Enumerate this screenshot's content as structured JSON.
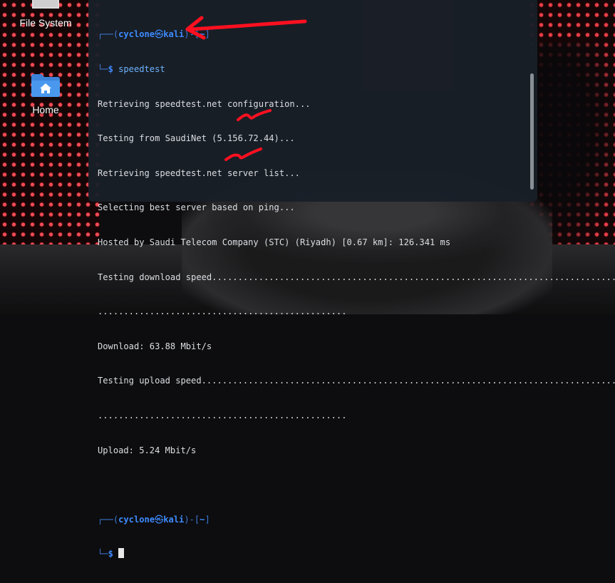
{
  "desktop": {
    "icons": [
      {
        "label": "File System",
        "icon": "drive-icon"
      },
      {
        "label": "Home",
        "icon": "home-folder-icon"
      }
    ]
  },
  "terminal": {
    "prompt1": {
      "frame_top": "┌──(",
      "user": "cyclone",
      "skull": "㉿",
      "host": "kali",
      "mid": ")-[",
      "path": "~",
      "end": "]",
      "frame_bottom": "└─",
      "symbol": "$",
      "command": "speedtest"
    },
    "output": [
      "Retrieving speedtest.net configuration...",
      "Testing from SaudiNet (5.156.72.44)...",
      "Retrieving speedtest.net server list...",
      "Selecting best server based on ping...",
      "Hosted by Saudi Telecom Company (STC) (Riyadh) [0.67 km]: 126.341 ms",
      "Testing download speed................................................................................",
      "................................................",
      "Download: 63.88 Mbit/s",
      "Testing upload speed................................................................................",
      "................................................",
      "Upload: 5.24 Mbit/s"
    ],
    "prompt2": {
      "frame_top": "┌──(",
      "user": "cyclone",
      "skull": "㉿",
      "host": "kali",
      "mid": ")-[",
      "path": "~",
      "end": "]",
      "frame_bottom": "└─",
      "symbol": "$"
    }
  },
  "colors": {
    "terminal_bg": "#191f28",
    "prompt_blue": "#3d8bff",
    "annotation_red": "#ff1020"
  }
}
